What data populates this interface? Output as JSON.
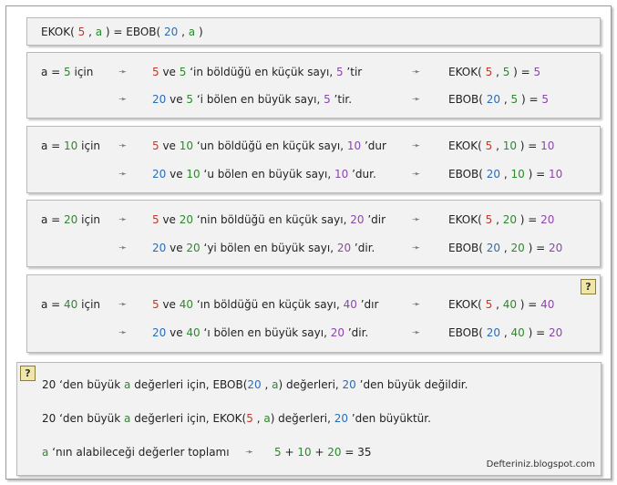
{
  "header": {
    "parts": [
      "EKOK( ",
      "5",
      " , ",
      "a",
      " )  =  EBOB( ",
      "20",
      " , ",
      "a",
      " )"
    ]
  },
  "arrow": "➛",
  "cases": [
    {
      "cond": [
        "a = ",
        "5",
        "   için"
      ],
      "line1": [
        "5",
        " ve ",
        "5",
        " ‘in böldüğü en küçük sayı, ",
        "5",
        " ’tir"
      ],
      "res1": [
        "EKOK( ",
        "5",
        " , ",
        "5",
        " )  =  ",
        "5"
      ],
      "line2": [
        "20",
        " ve ",
        "5",
        " ‘i bölen en büyük sayı, ",
        "5",
        " ’tir."
      ],
      "res2": [
        "EBOB( ",
        "20",
        " , ",
        "5",
        " )  =  ",
        "5"
      ]
    },
    {
      "cond": [
        "a = ",
        "10",
        "  için"
      ],
      "line1": [
        "5",
        " ve ",
        "10",
        " ‘un böldüğü en küçük sayı, ",
        "10",
        " ’dur"
      ],
      "res1": [
        "EKOK( ",
        "5",
        " , ",
        "10",
        " )  =  ",
        "10"
      ],
      "line2": [
        "20",
        " ve ",
        "10",
        " ‘u bölen en büyük sayı, ",
        "10",
        " ’dur."
      ],
      "res2": [
        "EBOB( ",
        "20",
        " , ",
        "10",
        " )  =  ",
        "10"
      ]
    },
    {
      "cond": [
        "a = ",
        "20",
        "  için"
      ],
      "line1": [
        "5",
        " ve ",
        "20",
        " ‘nin böldüğü en küçük sayı, ",
        "20",
        " ’dir"
      ],
      "res1": [
        "EKOK( ",
        "5",
        " , ",
        "20",
        " )  =  ",
        "20"
      ],
      "line2": [
        "20",
        " ve ",
        "20",
        " ‘yi bölen en büyük sayı, ",
        "20",
        " ’dir."
      ],
      "res2": [
        "EBOB( ",
        "20",
        " , ",
        "20",
        " )  =  ",
        "20"
      ]
    },
    {
      "cond": [
        "a = ",
        "40",
        "  için"
      ],
      "line1": [
        "5",
        " ve ",
        "40",
        " ‘ın böldüğü en küçük sayı, ",
        "40",
        " ’dır"
      ],
      "res1": [
        "EKOK( ",
        "5",
        " , ",
        "40",
        " )  =  ",
        "40"
      ],
      "line2": [
        "20",
        " ve ",
        "40",
        " ‘ı bölen en büyük sayı, ",
        "20",
        " ’dir."
      ],
      "res2": [
        "EBOB( ",
        "20",
        " , ",
        "40",
        " )  =  ",
        "20"
      ]
    }
  ],
  "hint_icon": "?",
  "conclusion": {
    "line1": [
      "20",
      " ‘den büyük ",
      "a",
      " değerleri için, EBOB(",
      "20",
      " , ",
      "a",
      ") değerleri, ",
      "20",
      " ’den büyük değildir."
    ],
    "line2": [
      "20",
      " ‘den büyük ",
      "a",
      " değerleri için, EKOK(",
      "5",
      " , ",
      "a",
      ") değerleri, ",
      "20",
      " ’den büyüktür."
    ],
    "line3_label": [
      "a",
      " ‘nın alabileceği değerler toplamı"
    ],
    "line3_sum": [
      "5",
      "  +  ",
      "10",
      "  +  ",
      "20",
      "   =   35"
    ]
  },
  "watermark": "Defteriniz.blogspot.com",
  "colors": {
    "red": "#c0392b",
    "green": "#2b8a2b",
    "blue": "#2a6cb8",
    "purple": "#8e44ad"
  }
}
